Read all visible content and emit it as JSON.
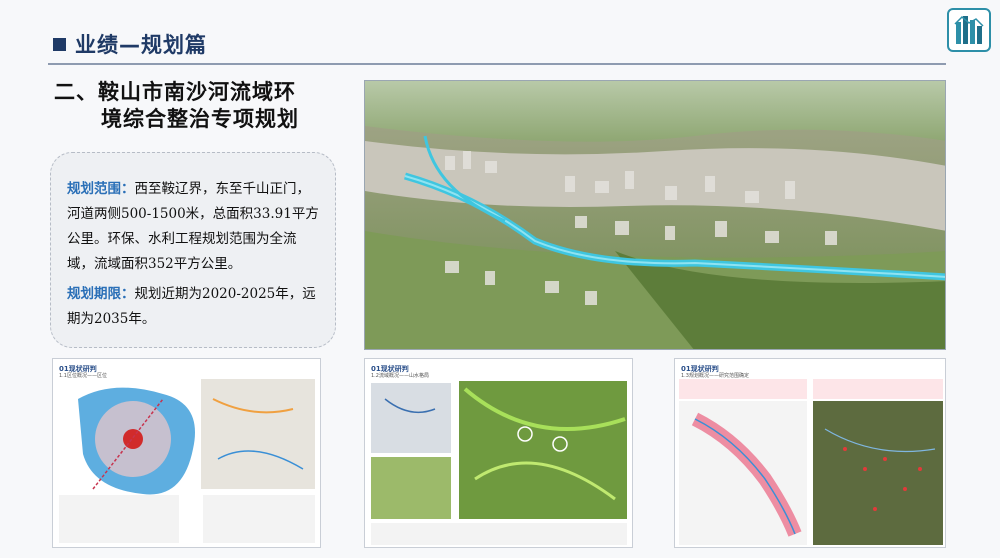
{
  "header": {
    "title": "业绩—规划篇"
  },
  "section": {
    "title_line1": "二、鞍山市南沙河流域环",
    "title_line2": "境综合整治专项规划"
  },
  "info": {
    "scope_label": "规划范围：",
    "scope_text": "西至鞍辽界，东至千山正门，河道两侧500-1500米，总面积33.91平方公里。环保、水利工程规划范围为全流域，流域面积352平方公里。",
    "period_label": "规划期限：",
    "period_text": "规划近期为2020-2025年，远期为2035年。"
  },
  "thumbnails": [
    {
      "heading": "01现状研判",
      "subheading": "1.1区位概况——区位"
    },
    {
      "heading": "01现状研判",
      "subheading": "1.2流域概况——山水格局"
    },
    {
      "heading": "01现状研判",
      "subheading": "1.3规划概况——研究范围确定"
    }
  ],
  "colors": {
    "title_blue": "#1f3a66",
    "label_blue": "#2a6fb7",
    "river": "#3fc6e0"
  },
  "icons": {
    "logo": "building-logo-icon"
  }
}
